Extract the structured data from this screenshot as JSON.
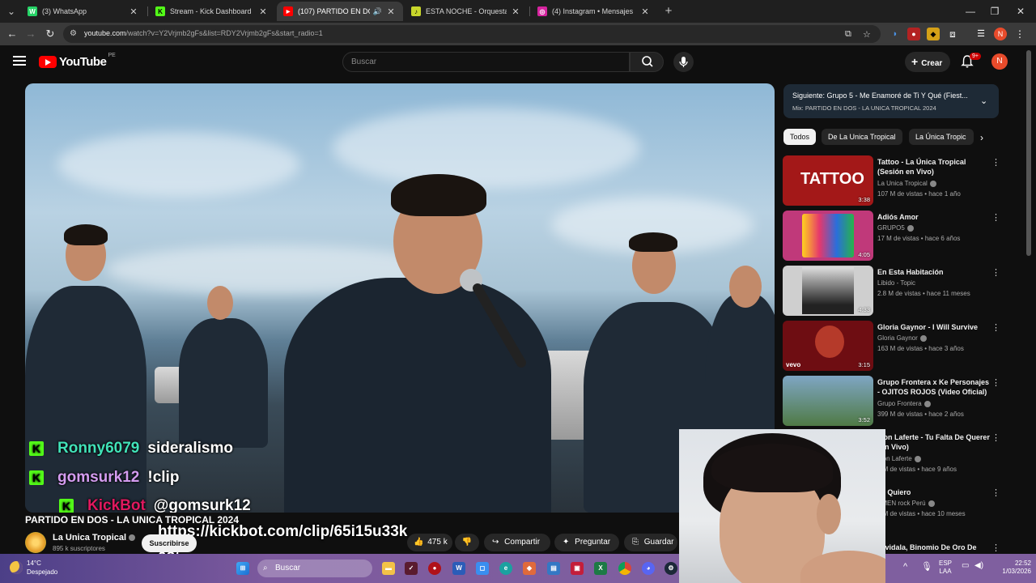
{
  "browser": {
    "tabs": [
      {
        "label": "(3) WhatsApp",
        "favicon_color": "#25d366",
        "favicon_glyph": "W"
      },
      {
        "label": "Stream - Kick Dashboard",
        "favicon_color": "#53fc18",
        "favicon_glyph": "K"
      },
      {
        "label": "(107) PARTIDO EN DOS - LA",
        "favicon_color": "#ff0000",
        "favicon_glyph": "▶",
        "active": true
      },
      {
        "label": "ESTA NOCHE - Orquesta Cand",
        "favicon_color": "#c8d62b",
        "favicon_glyph": "♪"
      },
      {
        "label": "(4) Instagram • Mensajes",
        "favicon_color": "#d6249f",
        "favicon_glyph": "◎"
      }
    ],
    "url_host": "youtube.com",
    "url_rest": "/watch?v=Y2Vrjmb2gFs&list=RDY2Vrjmb2gFs&start_radio=1",
    "profile_initial": "N"
  },
  "youtube": {
    "logo_text": "YouTube",
    "country_code": "PE",
    "search_placeholder": "Buscar",
    "create_label": "Crear",
    "notif_badge": "9+",
    "avatar_initial": "N"
  },
  "video": {
    "title": "PARTIDO EN DOS - LA UNICA TROPICAL 2024",
    "channel": "La Unica Tropical",
    "subscribers": "895 k suscriptores",
    "subscribe_label": "Suscribirse",
    "likes": "475 k",
    "share_label": "Compartir",
    "ask_label": "Preguntar",
    "save_label": "Guardar"
  },
  "chat_overlay": [
    {
      "badge": "K",
      "user": "Ronny6079",
      "user_color": "#41e2b8",
      "message": "sideralismo"
    },
    {
      "badge": "K",
      "user": "gomsurk12",
      "user_color": "#d49cf0",
      "message": "!clip"
    },
    {
      "badge": "K",
      "user": "KickBot",
      "user_color": "#e0195f",
      "message": "@gomsurk12"
    }
  ],
  "chat_url_line1": "https://kickbot.com/clip/65i15u33k",
  "chat_url_line2": "08t",
  "sidebar": {
    "next_title": "Siguiente: Grupo 5 - Me Enamoré de Ti Y Qué (Fiest...",
    "next_sub": "Mix: PARTIDO EN DOS - LA UNICA TROPICAL 2024",
    "chips": [
      "Todos",
      "De La Unica Tropical",
      "La Única Tropic"
    ],
    "recommendations": [
      {
        "title": "Tattoo - La Única Tropical (Sesión en Vivo)",
        "channel": "La Unica Tropical",
        "meta": "107 M de vistas • hace 1 año",
        "duration": "3:38",
        "thumb_color": "#a31818"
      },
      {
        "title": "Adiós Amor",
        "channel": "GRUPO5",
        "meta": "17 M de vistas • hace 6 años",
        "duration": "4:05",
        "thumb_color": "#c0397a"
      },
      {
        "title": "En Esta Habitación",
        "channel": "Libido - Topic",
        "meta": "2.8 M de vistas • hace 11 meses",
        "duration": "4:33",
        "thumb_color": "#cfcfcf"
      },
      {
        "title": "Gloria Gaynor - I Will Survive",
        "channel": "Gloria Gaynor",
        "meta": "163 M de vistas • hace 3 años",
        "duration": "3:15",
        "thumb_color": "#6e0d12"
      },
      {
        "title": "Grupo Frontera x Ke Personajes - OJITOS ROJOS (Video Oficial)",
        "channel": "Grupo Frontera",
        "meta": "399 M de vistas • hace 2 años",
        "duration": "3:52",
        "thumb_color": "#5c7d4a"
      },
      {
        "title": "Mon Laferte - Tu Falta De Querer (En Vivo)",
        "channel": "Mon Laferte",
        "meta": "6 M de vistas • hace 9 años",
        "duration": "",
        "thumb_color": "#333333"
      },
      {
        "title": "Te Quiero",
        "channel": "AMEN rock Perú",
        "meta": "2 M de vistas • hace 10 meses",
        "duration": "",
        "thumb_color": "#333333"
      },
      {
        "title": "Olvidala, Binomio De Oro De",
        "channel": "",
        "meta": "",
        "duration": "",
        "thumb_color": "#333333"
      }
    ]
  },
  "taskbar": {
    "weather_temp": "14°C",
    "weather_desc": "Despejado",
    "search_placeholder": "Buscar",
    "lang_line1": "ESP",
    "lang_line2": "LAA",
    "time": "22:52",
    "date": "1/03/2026"
  }
}
